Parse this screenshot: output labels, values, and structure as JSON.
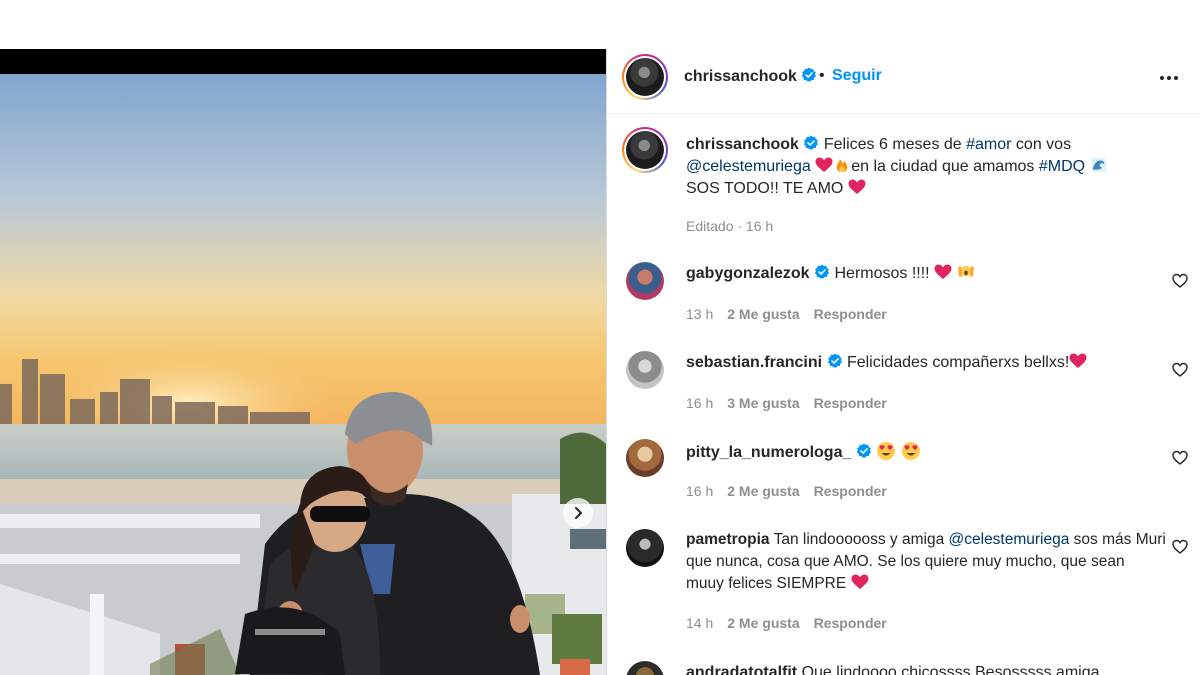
{
  "post": {
    "author": "chrissanchook",
    "follow_label": "Seguir",
    "separator": "•",
    "more_icon": "more-horizontal-icon",
    "verified_color": "#0095f6",
    "caption": {
      "text_1": "Felices 6 meses de ",
      "hashtag_1": "#amor",
      "text_2": " con vos",
      "mention": "@celestemuriega",
      "text_3": "en la ciudad que amamos ",
      "hashtag_2": "#MDQ",
      "text_4": "SOS TODO!! TE AMO",
      "meta": "Editado · 16 h"
    }
  },
  "comments": [
    {
      "user": "gabygonzalezok",
      "verified": true,
      "text": "Hermosos !!!! ",
      "time": "13 h",
      "likes": "2 Me gusta",
      "reply": "Responder"
    },
    {
      "user": "sebastian.francini",
      "verified": true,
      "text": "Felicidades compañerxs bellxs!",
      "time": "16 h",
      "likes": "3 Me gusta",
      "reply": "Responder"
    },
    {
      "user": "pitty_la_numerologa_",
      "verified": true,
      "text": "",
      "time": "16 h",
      "likes": "2 Me gusta",
      "reply": "Responder"
    },
    {
      "user": "pametropia",
      "verified": false,
      "text_1": "Tan lindoooooss y amiga ",
      "mention": "@celestemuriega",
      "text_2": " sos más Muri que nunca, cosa que AMO. Se los quiere muy mucho, que sean muuy felices SIEMPRE ",
      "time": "14 h",
      "likes": "2 Me gusta",
      "reply": "Responder"
    },
    {
      "user": "andradatotalfit",
      "verified": false,
      "text": "Que lindoooo chicossss Besosssss amiga"
    }
  ],
  "colors": {
    "link": "#00376b",
    "follow": "#0095f6",
    "muted": "#8e8e8e"
  }
}
